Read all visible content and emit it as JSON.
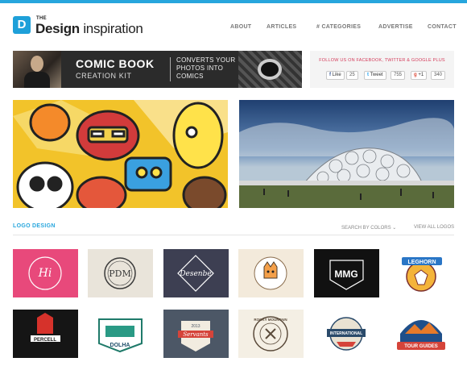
{
  "header": {
    "logo_mark": "D",
    "logo_the": "THE",
    "logo_design": "Design",
    "logo_inspiration": " inspiration",
    "nav": [
      {
        "label": "ABOUT"
      },
      {
        "label": "ARTICLES"
      },
      {
        "label": "# CATEGORIES"
      },
      {
        "label": "ADVERTISE"
      },
      {
        "label": "CONTACT"
      }
    ]
  },
  "banner": {
    "title": "COMIC BOOK",
    "subtitle": "CREATION KIT",
    "converts": "CONVERTS YOUR PHOTOS INTO COMICS"
  },
  "social": {
    "follow_text": "FOLLOW US ON FACEBOOK, TWITTER & GOOGLE PLUS",
    "like_label": "Like",
    "like_count": "25",
    "tweet_label": "Tweet",
    "tweet_count": "755",
    "gplus_label": "+1",
    "gplus_count": "340"
  },
  "section": {
    "title": "LOGO DESIGN",
    "search_by_colors": "SEARCH BY COLORS",
    "view_all": "VIEW ALL LOGOS"
  },
  "logos": {
    "row1": [
      {
        "text": "Hi",
        "bg": "#e8497b"
      },
      {
        "text": "PDM",
        "bg": "#e9e4da"
      },
      {
        "text": "Desenbe",
        "bg": "#3d3f52"
      },
      {
        "text": "",
        "bg": "#f3eadb"
      },
      {
        "text": "MMG",
        "bg": "#111111"
      },
      {
        "text": "LEGHORN",
        "bg": "#ffffff"
      }
    ],
    "row2": [
      {
        "text": "PERCELL",
        "bg": "#151515"
      },
      {
        "text": "DOLHA",
        "bg": "#ffffff"
      },
      {
        "text": "Servants",
        "year": "2013",
        "bg": "#4c5766"
      },
      {
        "text": "ROCKY MOUNTAIN",
        "bg": "#f4efe4"
      },
      {
        "text": "INTERNATIONAL",
        "bg": "#ffffff"
      },
      {
        "text": "TOUR GUIDES",
        "bg": "#ffffff"
      }
    ]
  },
  "colors": {
    "accent": "#27a6dd",
    "social_red": "#d43b5a"
  }
}
